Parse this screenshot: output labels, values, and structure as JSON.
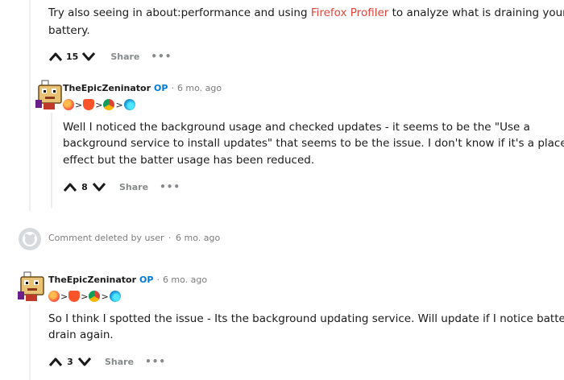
{
  "comment_top": {
    "line1_pre": "Try also seeing in about:performance and using ",
    "line1_link": "Firefox Profiler",
    "line1_post": " to analyze what is draining your",
    "line2": "battery.",
    "score": "15",
    "share_label": "Share",
    "more_label": "•••"
  },
  "reply1": {
    "author": "TheEpicZeninator",
    "op_badge": "OP",
    "separator": "·",
    "time": "6 mo. ago",
    "flair_sep": ">",
    "body_lines": [
      "Well I noticed the background usage and checked updates - it seems to be the \"Use a",
      "background service to install updates\" that seems to be the issue. I don't know if it's a placebo",
      "effect but the batter usage has been reduced."
    ],
    "score": "8",
    "share_label": "Share",
    "more_label": "•••"
  },
  "deleted": {
    "text": "Comment deleted by user",
    "separator": "·",
    "time": "6 mo. ago"
  },
  "reply2": {
    "author": "TheEpicZeninator",
    "op_badge": "OP",
    "separator": "·",
    "time": "6 mo. ago",
    "flair_sep": ">",
    "body_lines": [
      "So I think I spotted the issue - Its the background updating service. Will update if I notice battery",
      "drain again."
    ],
    "score": "3",
    "share_label": "Share",
    "more_label": "•••"
  },
  "icons": [
    "arrow-up-icon",
    "arrow-down-icon",
    "firefox-icon",
    "brave-icon",
    "chrome-icon",
    "edge-icon",
    "avatar-icon",
    "deleted-user-icon"
  ]
}
